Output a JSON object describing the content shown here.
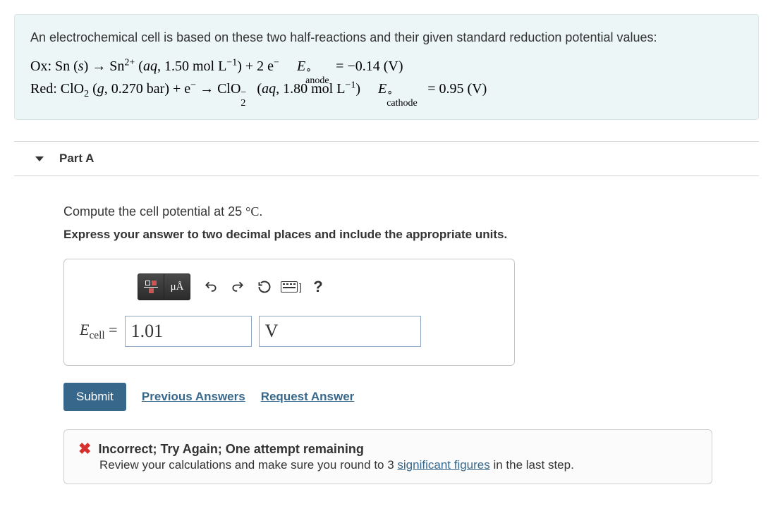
{
  "problem": {
    "intro": "An electrochemical cell is based on these two half-reactions and their given standard reduction potential values:",
    "ox_label": "Ox:",
    "red_label": "Red:",
    "sn_conc": "1.50",
    "clo2_pressure": "0.270",
    "clo2minus_conc": "1.80",
    "e_anode_label": "anode",
    "e_anode_value": "−0.14 (V)",
    "e_cathode_label": "cathode",
    "e_cathode_value": "0.95 (V)"
  },
  "part": {
    "title": "Part A",
    "prompt1_pre": "Compute the cell potential at 25 ",
    "prompt1_post": ".",
    "prompt2": "Express your answer to two decimal places and include the appropriate units.",
    "lhs_symbol": "E",
    "lhs_sub": "cell",
    "equals": " = ",
    "value": "1.01",
    "unit": "V"
  },
  "toolbar": {
    "units_label": "μÅ",
    "undo": "↶",
    "redo": "↷",
    "reset": "↻",
    "help": "?"
  },
  "actions": {
    "submit": "Submit",
    "previous": "Previous Answers",
    "request": "Request Answer"
  },
  "feedback": {
    "title": "Incorrect; Try Again; One attempt remaining",
    "body_pre": "Review your calculations and make sure you round to 3 ",
    "sig_link": "significant figures",
    "body_post": " in the last step."
  }
}
